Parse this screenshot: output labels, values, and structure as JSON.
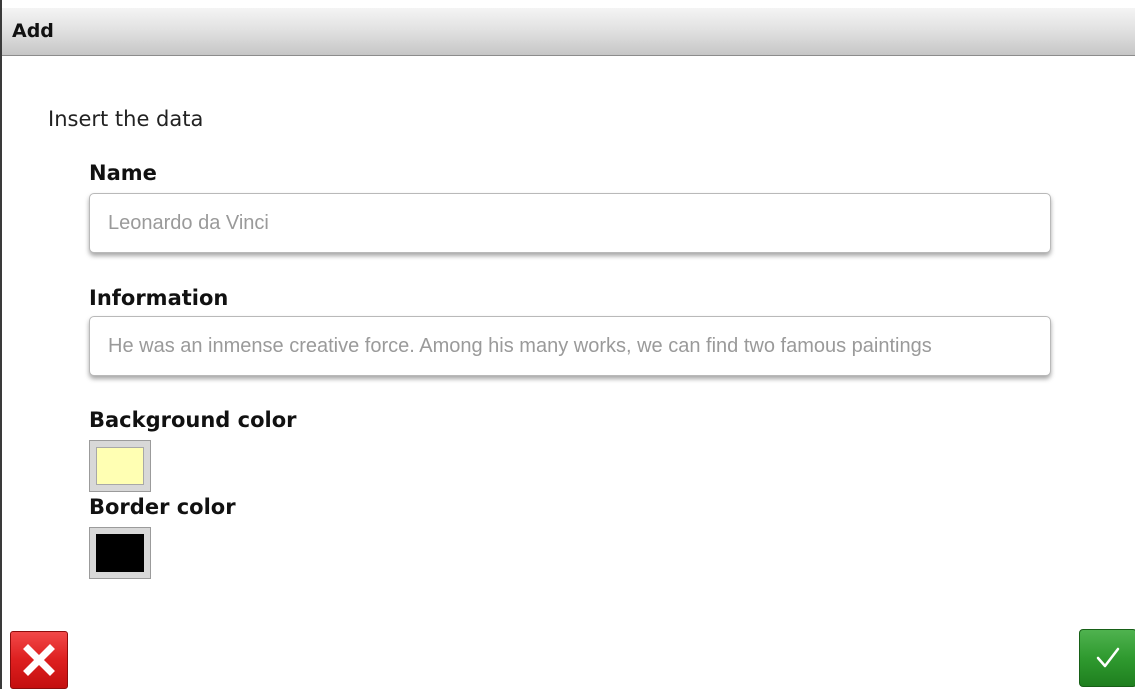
{
  "dialog": {
    "title": "Add",
    "intro": "Insert the data"
  },
  "form": {
    "name": {
      "label": "Name",
      "value": "Leonardo da Vinci"
    },
    "information": {
      "label": "Information",
      "value": "He was an inmense creative force. Among his many works, we can find two famous paintings"
    },
    "background_color": {
      "label": "Background color",
      "value": "#ffffb3"
    },
    "border_color": {
      "label": "Border color",
      "value": "#000000"
    }
  },
  "actions": {
    "cancel_icon": "close-icon",
    "cancel_color": "#dd1f1f",
    "confirm_icon": "checkmark-icon",
    "confirm_color": "#2f9a2f"
  }
}
